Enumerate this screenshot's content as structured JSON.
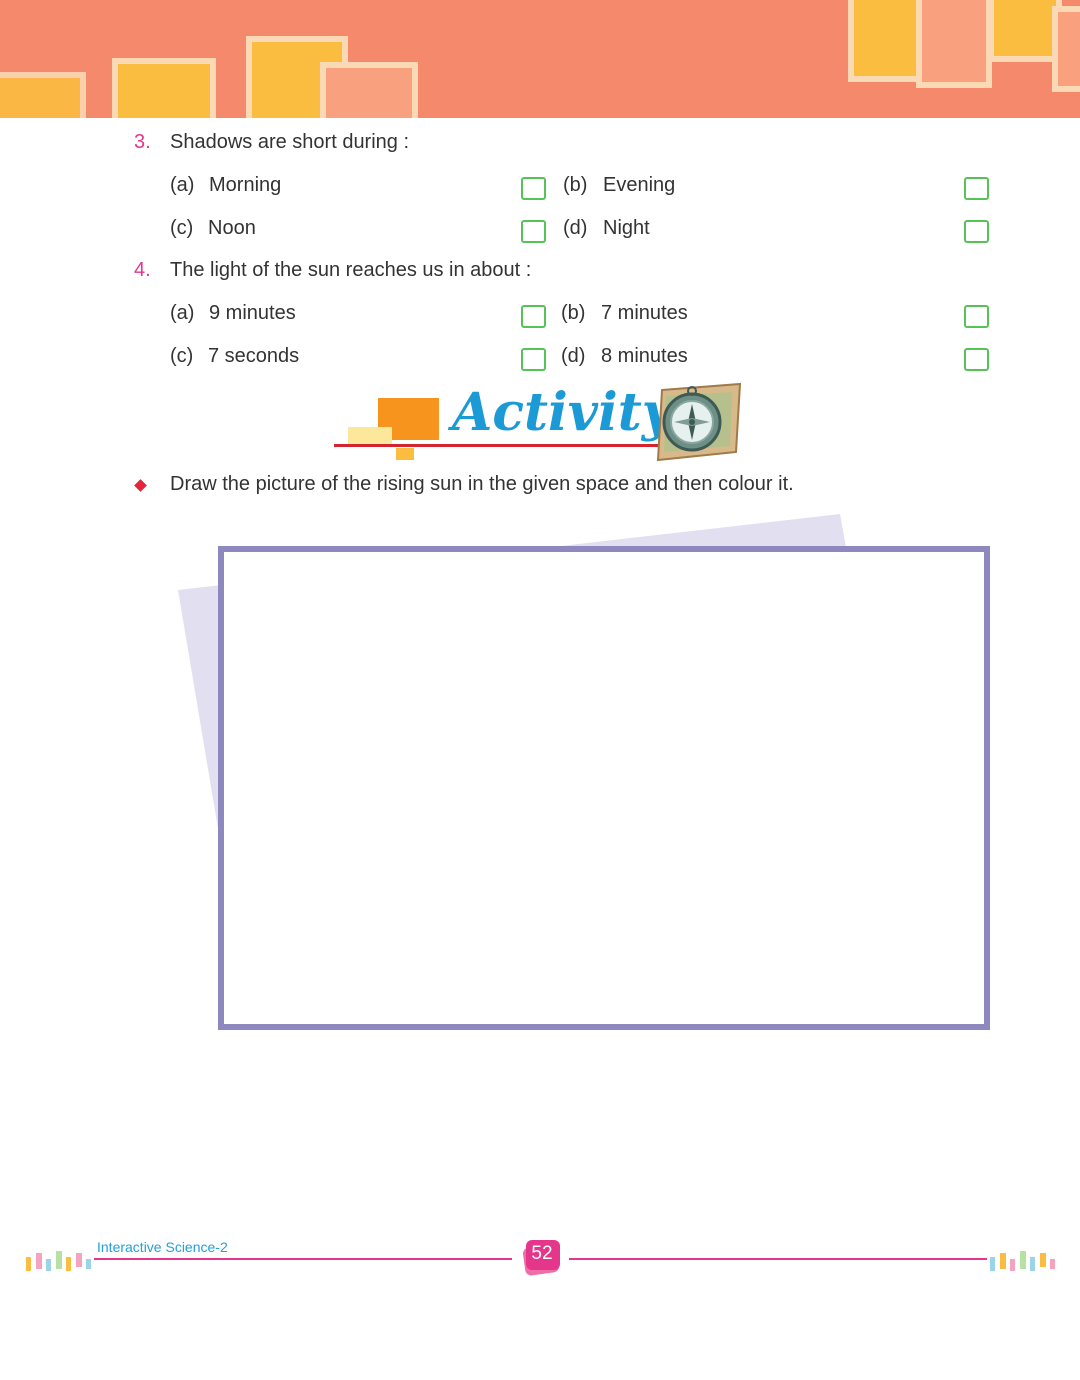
{
  "questions": [
    {
      "number": "3.",
      "text": "Shadows are short during :",
      "options": [
        {
          "letter": "(a)",
          "text": "Morning"
        },
        {
          "letter": "(b)",
          "text": "Evening"
        },
        {
          "letter": "(c)",
          "text": "Noon"
        },
        {
          "letter": "(d)",
          "text": "Night"
        }
      ]
    },
    {
      "number": "4.",
      "text": "The light of the sun reaches us in about :",
      "options": [
        {
          "letter": "(a)",
          "text": "9 minutes"
        },
        {
          "letter": "(b)",
          "text": "7 minutes"
        },
        {
          "letter": "(c)",
          "text": "7 seconds"
        },
        {
          "letter": "(d)",
          "text": "8 minutes"
        }
      ]
    }
  ],
  "activity": {
    "title": "Activity",
    "instruction": "Draw the picture of the rising sun in the given space and then colour it."
  },
  "footer": {
    "book_title": "Interactive Science-2",
    "page_number": "52"
  },
  "colors": {
    "header": "#f5896c",
    "accent_yellow": "#fbbd3f",
    "question_number": "#e4368a",
    "checkbox_border": "#57c257",
    "activity_title": "#1c9ad6",
    "draw_box_border": "#8f88bf",
    "footer_line": "#e4368a"
  },
  "icons": {
    "activity": "compass-map-icon",
    "bullet": "diamond-bullet-icon"
  }
}
